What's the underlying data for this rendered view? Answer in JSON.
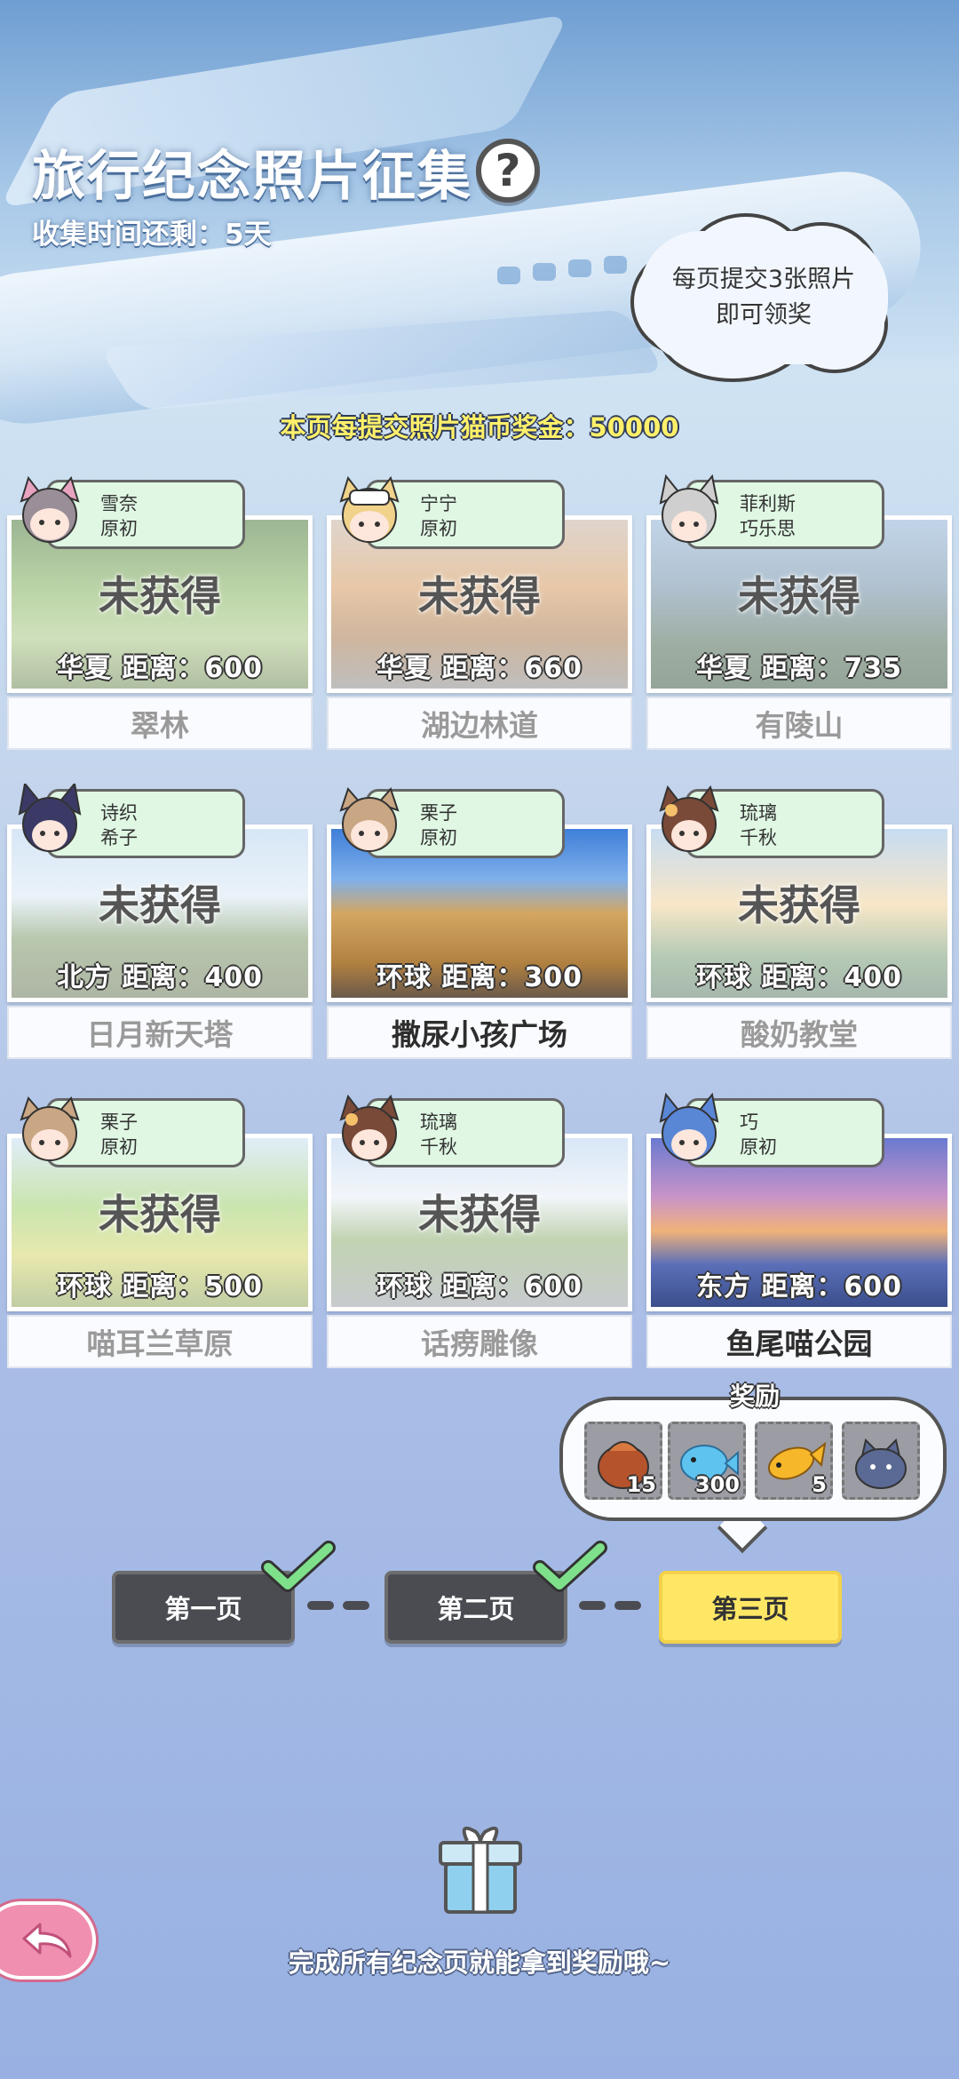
{
  "header": {
    "title": "旅行纪念照片征集",
    "help_label": "?",
    "countdown": "收集时间还剩：5天",
    "tip_line1": "每页提交3张照片",
    "tip_line2": "即可领奖",
    "bonus": "本页每提交照片猫币奖金：50000"
  },
  "cards": [
    {
      "char1": "雪奈",
      "char2": "原初",
      "status": "未获得",
      "dist": "华夏  距离：600",
      "name": "翠林",
      "got": false
    },
    {
      "char1": "宁宁",
      "char2": "原初",
      "status": "未获得",
      "dist": "华夏  距离：660",
      "name": "湖边林道",
      "got": false
    },
    {
      "char1": "菲利斯",
      "char2": "巧乐思",
      "status": "未获得",
      "dist": "华夏  距离：735",
      "name": "有陵山",
      "got": false
    },
    {
      "char1": "诗织",
      "char2": "希子",
      "status": "未获得",
      "dist": "北方  距离：400",
      "name": "日月新天塔",
      "got": false
    },
    {
      "char1": "栗子",
      "char2": "原初",
      "status": "",
      "dist": "环球  距离：300",
      "name": "撒尿小孩广场",
      "got": true
    },
    {
      "char1": "琉璃",
      "char2": "千秋",
      "status": "未获得",
      "dist": "环球  距离：400",
      "name": "酸奶教堂",
      "got": false
    },
    {
      "char1": "栗子",
      "char2": "原初",
      "status": "未获得",
      "dist": "环球  距离：500",
      "name": "喵耳兰草原",
      "got": false
    },
    {
      "char1": "琉璃",
      "char2": "千秋",
      "status": "未获得",
      "dist": "环球  距离：600",
      "name": "话痨雕像",
      "got": false
    },
    {
      "char1": "巧",
      "char2": "原初",
      "status": "",
      "dist": "东方  距离：600",
      "name": "鱼尾喵公园",
      "got": true
    }
  ],
  "rewards": {
    "label": "奖励",
    "items": [
      {
        "icon": "cat-food-bag-icon",
        "count": "15"
      },
      {
        "icon": "blue-fish-icon",
        "count": "300"
      },
      {
        "icon": "golden-fish-icon",
        "count": "5"
      },
      {
        "icon": "cat-plush-icon",
        "count": ""
      }
    ]
  },
  "pages": {
    "page1": "第一页",
    "page2": "第二页",
    "page3": "第三页",
    "current": 3
  },
  "footer": {
    "complete_text": "完成所有纪念页就能拿到奖励哦~"
  },
  "colors": {
    "tag_bg": "#dff7e3",
    "active_page": "#ffe766",
    "page_btn": "#4a4c52",
    "check": "#7ee08a",
    "back_button": "#f08fb0"
  }
}
